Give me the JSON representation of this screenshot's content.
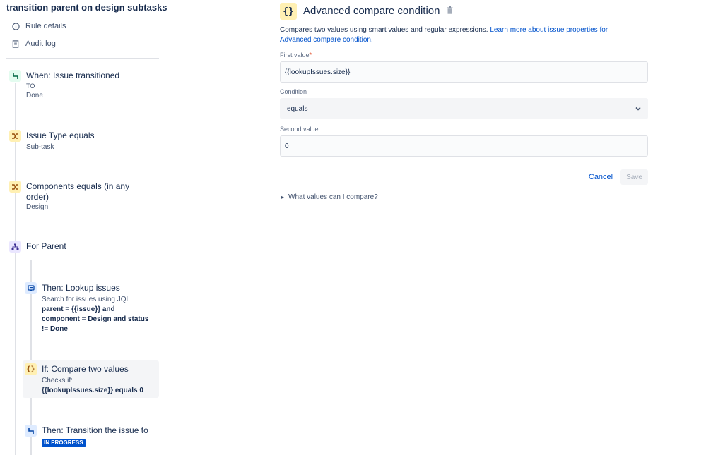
{
  "rule": {
    "title": "transition parent on design subtasks",
    "nav": [
      {
        "label": "Rule details",
        "icon": "info-icon"
      },
      {
        "label": "Audit log",
        "icon": "document-icon"
      }
    ]
  },
  "steps": {
    "trigger": {
      "title": "When: Issue transitioned",
      "line1": "TO",
      "line2": "Done",
      "icon": "transition-icon"
    },
    "cond1": {
      "title": "Issue Type equals",
      "line1": "Sub-task",
      "icon": "shuffle-icon"
    },
    "cond2": {
      "title": "Components equals (in any",
      "title2": "order)",
      "line1": "Design",
      "icon": "shuffle-icon"
    },
    "branch": {
      "title": "For Parent",
      "icon": "branch-tree-icon"
    },
    "lookup": {
      "title": "Then: Lookup issues",
      "line1": "Search for issues using JQL",
      "jql1": "parent = {{issue}} and",
      "jql2": "component = Design and status",
      "jql3": "!= Done",
      "icon": "lookup-icon"
    },
    "compare": {
      "title": "If: Compare two values",
      "line1": "Checks if:",
      "expr": "{{lookupIssues.size}} equals 0",
      "icon": "braces-icon",
      "icon_glyph": "{}"
    },
    "transition": {
      "title": "Then: Transition the issue to",
      "status": "IN PROGRESS",
      "icon": "transition-icon"
    }
  },
  "panel": {
    "icon_glyph": "{}",
    "title": "Advanced compare condition",
    "description": "Compares two values using smart values and regular expressions. ",
    "link1": "Learn more about issue properties for",
    "link2": "Advanced compare condition.",
    "first_value_label": "First value",
    "required_mark": "*",
    "first_value": "{{lookupIssues.size}}",
    "condition_label": "Condition",
    "condition_value": "equals",
    "second_value_label": "Second value",
    "second_value": "0",
    "cancel_label": "Cancel",
    "save_label": "Save",
    "disclosure_label": "What values can I compare?"
  },
  "colors": {
    "accent": "#0052CC",
    "status_lozenge": "#0052CC",
    "condition_badge": "#FFF0B3",
    "trigger_badge": "#E3FCEF",
    "branch_badge": "#EAE6FF",
    "action_badge": "#DEEBFF"
  }
}
